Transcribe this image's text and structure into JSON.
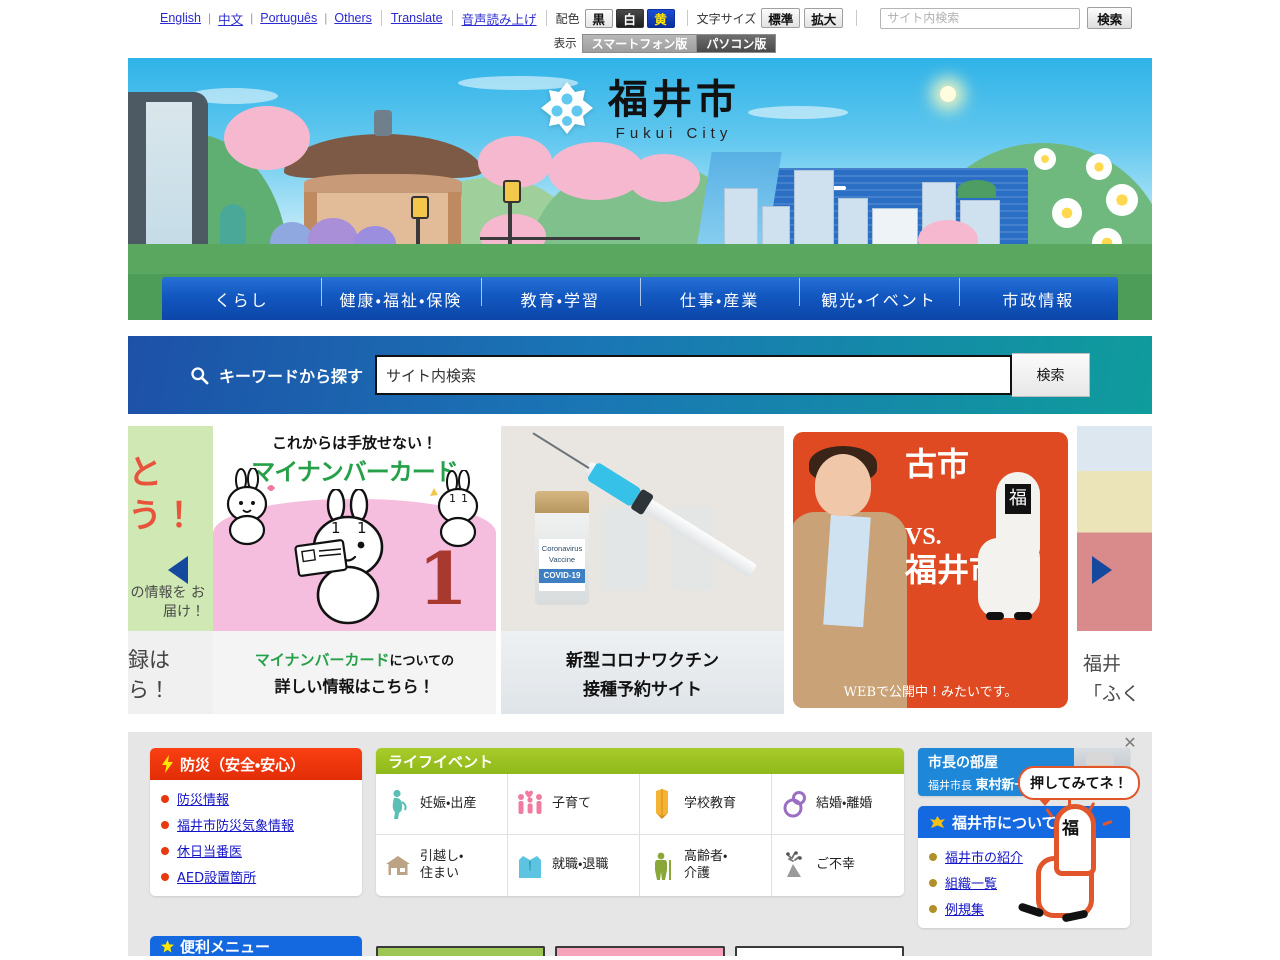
{
  "utility": {
    "languages": [
      {
        "label": "English"
      },
      {
        "label": "中文"
      },
      {
        "label": "Português"
      },
      {
        "label": "Others"
      },
      {
        "label": "Translate"
      }
    ],
    "voice_read_label": "音声読み上げ",
    "color_scheme_label": "配色",
    "color_buttons": [
      {
        "label": "黒",
        "mode": "black"
      },
      {
        "label": "白",
        "mode": "white"
      },
      {
        "label": "黄",
        "mode": "yellow"
      }
    ],
    "font_size_label": "文字サイズ",
    "font_buttons": [
      {
        "label": "標準"
      },
      {
        "label": "拡大"
      }
    ],
    "top_search": {
      "placeholder": "サイト内検索",
      "value": "",
      "button_label": "検索"
    },
    "display_label": "表示",
    "display_buttons": [
      {
        "label": "スマートフォン版",
        "active": false
      },
      {
        "label": "パソコン版",
        "active": true
      }
    ]
  },
  "header": {
    "logo_jp": "福井市",
    "logo_en": "Fukui City",
    "nav": [
      {
        "label": "くらし"
      },
      {
        "label": "健康・福祉・保険"
      },
      {
        "label": "教育・学習"
      },
      {
        "label": "仕事・産業"
      },
      {
        "label": "観光・イベント"
      },
      {
        "label": "市政情報"
      }
    ]
  },
  "keyword_search": {
    "label": "キーワードから探す",
    "placeholder": "サイト内検索",
    "value": "サイト内検索",
    "button_label": "検索"
  },
  "carousel": {
    "prev_label": "◀",
    "next_label": "▶",
    "slides": [
      {
        "name": "mail-magazine-partial",
        "top_big": "と\nう！",
        "top_sub": "の情報を\nお届け！",
        "bottom_text": "録は\nら！"
      },
      {
        "name": "my-number-card",
        "headline": "これからは手放せない！",
        "title": "マイナンバーカード",
        "number": "1",
        "caption_green": "マイナンバーカード",
        "caption_black": "についての",
        "caption_line2": "詳しい情報はこちら！"
      },
      {
        "name": "covid-vaccine",
        "vial_text_1": "Coronavirus",
        "vial_text_2": "Vaccine",
        "vial_text_3": "COVID-19",
        "caption_line1": "新型コロナワクチン",
        "caption_line2": "接種予約サイト"
      },
      {
        "name": "furuichi-vs-fukui",
        "title_1": "古市",
        "vs": "VS.",
        "title_2": "福井市",
        "kanji_mark": "福",
        "footer": "WEBで公開中！みたいです。"
      },
      {
        "name": "fukui-brand-partial",
        "line1": "福井",
        "line2": "「ふく"
      }
    ]
  },
  "bousai_panel": {
    "title": "防災（安全・安心）",
    "icon": "lightning-icon",
    "links": [
      {
        "label": "防災情報"
      },
      {
        "label": "福井市防災気象情報"
      },
      {
        "label": "休日当番医"
      },
      {
        "label": "AED設置箇所"
      }
    ]
  },
  "life_events": {
    "title": "ライフイベント",
    "items": [
      {
        "label": "妊娠・出産",
        "icon": "pregnant-woman-icon",
        "color": "#5bbfb5"
      },
      {
        "label": "子育て",
        "icon": "family-icon",
        "color": "#f07ca0"
      },
      {
        "label": "学校教育",
        "icon": "pencil-icon",
        "color": "#f5b335"
      },
      {
        "label": "結婚・離婚",
        "icon": "rings-icon",
        "color": "#9b6fc4"
      },
      {
        "label": "引越し・\n住まい",
        "icon": "house-icon",
        "color": "#bda385"
      },
      {
        "label": "就職・退職",
        "icon": "suit-icon",
        "color": "#5cc3e0"
      },
      {
        "label": "高齢者・\n介護",
        "icon": "elderly-icon",
        "color": "#8aa83a"
      },
      {
        "label": "ご不幸",
        "icon": "bouquet-icon",
        "color": "#7a7a7a"
      }
    ]
  },
  "mayor_banner": {
    "title": "市長の部屋",
    "subtitle_prefix": "福井市長",
    "subtitle_name": "東村新一"
  },
  "about_panel": {
    "title": "福井市について",
    "icon": "phoenix-icon",
    "links": [
      {
        "label": "福井市の紹介"
      },
      {
        "label": "組織一覧"
      },
      {
        "label": "例規集"
      }
    ]
  },
  "convenience_panel": {
    "title": "便利メニュー",
    "icon": "star-icon"
  },
  "mascot_popup": {
    "bubble_text": "押してみてネ！",
    "kanji": "福",
    "close_label": "✕"
  },
  "colors": {
    "nav_blue": "#1257c0",
    "search_band_start": "#1d51a8",
    "search_band_end": "#0f9c9c",
    "bousai_red": "#e22d06",
    "life_green": "#8fb81a",
    "panel_blue": "#1569e0",
    "mayor_blue": "#1e87d8",
    "mascot_orange": "#e2562c",
    "link_blue": "#1414c8"
  }
}
